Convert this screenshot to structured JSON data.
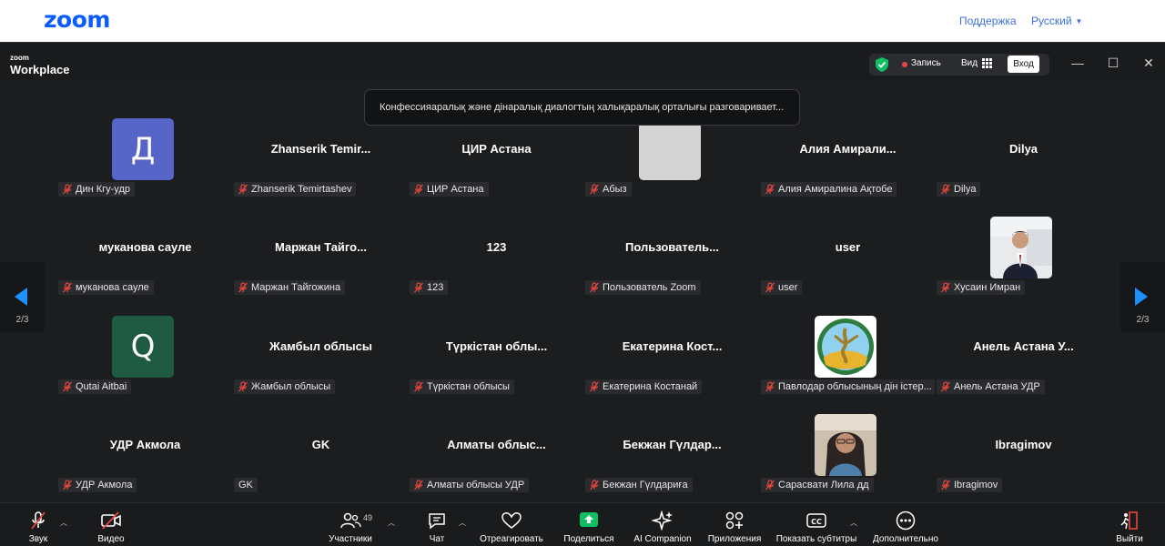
{
  "web": {
    "logo": "zoom",
    "support": "Поддержка",
    "language": "Русский"
  },
  "titlebar": {
    "brand_small": "zoom",
    "brand_big": "Workplace",
    "record_label": "Запись",
    "view_label": "Вид",
    "enter_label": "Вход",
    "minimize": "—",
    "maximize": "☐",
    "close": "✕"
  },
  "speaker_tip": "Конфессияаралық және дінаралық диалогтың халықаралық орталығы разговаривает...",
  "nav": {
    "left_page": "2/3",
    "right_page": "2/3"
  },
  "participants": [
    {
      "name": "",
      "label": "Дин Кгу-удр",
      "avatar": "Д",
      "avatar_color": "#5865c8",
      "mic_off": true
    },
    {
      "name": "Zhanserik  Temir...",
      "label": "Zhanserik Temirtashev",
      "mic_off": true
    },
    {
      "name": "ЦИР Астана",
      "label": "ЦИР Астана",
      "mic_off": true
    },
    {
      "name": "",
      "label": "Абыз",
      "avatar": "",
      "avatar_color": "#d4d4d4",
      "mic_off": true
    },
    {
      "name": "Алия  Амирали...",
      "label": "Алия Амиралина Ақтобе",
      "mic_off": true
    },
    {
      "name": "Dilya",
      "label": "Dilya",
      "mic_off": true
    },
    {
      "name": "муканова сауле",
      "label": "муканова сауле",
      "mic_off": true
    },
    {
      "name": "Маржан  Тайго...",
      "label": "Маржан Тайгожина",
      "mic_off": true
    },
    {
      "name": "123",
      "label": "123",
      "mic_off": true
    },
    {
      "name": "Пользователь...",
      "label": "Пользователь Zoom",
      "mic_off": true
    },
    {
      "name": "user",
      "label": "user",
      "mic_off": true
    },
    {
      "name": "",
      "label": "Хусаин Имран",
      "photo": "man",
      "mic_off": true
    },
    {
      "name": "",
      "label": "Qutai Aitbai",
      "avatar": "Q",
      "avatar_color": "#1f5b43",
      "mic_off": true
    },
    {
      "name": "Жамбыл облысы",
      "label": "Жамбыл облысы",
      "mic_off": true
    },
    {
      "name": "Түркістан  облы...",
      "label": "Түркістан облысы",
      "mic_off": true
    },
    {
      "name": "Екатерина  Кост...",
      "label": "Екатерина Костанай",
      "mic_off": true
    },
    {
      "name": "",
      "label": "Павлодар облысының дін істер...",
      "photo": "emblem",
      "mic_off": true
    },
    {
      "name": "Анель Астана У...",
      "label": "Анель Астана УДР",
      "mic_off": true
    },
    {
      "name": "УДР Акмола",
      "label": "УДР Акмола",
      "mic_off": true
    },
    {
      "name": "GK",
      "label": "GK",
      "mic_off": false
    },
    {
      "name": "Алматы  облыс...",
      "label": "Алматы облысы УДР",
      "mic_off": true
    },
    {
      "name": "Бекжан  Гүлдар...",
      "label": "Бекжан Гүлдариға",
      "mic_off": true
    },
    {
      "name": "",
      "label": "Сарасвати Лила дд",
      "photo": "woman",
      "mic_off": true
    },
    {
      "name": "Ibragimov",
      "label": "Ibragimov",
      "mic_off": true
    }
  ],
  "toolbar": {
    "audio": "Звук",
    "video": "Видео",
    "participants": "Участники",
    "participants_count": "49",
    "chat": "Чат",
    "react": "Отреагировать",
    "share": "Поделиться",
    "ai": "AI Companion",
    "apps": "Приложения",
    "captions": "Показать субтитры",
    "more": "Дополнительно",
    "leave": "Выйти"
  },
  "colors": {
    "accent": "#0b5cff",
    "share_green": "#0fbf63",
    "mic_off_red": "#e8463c",
    "background": "#1c1d1f"
  }
}
